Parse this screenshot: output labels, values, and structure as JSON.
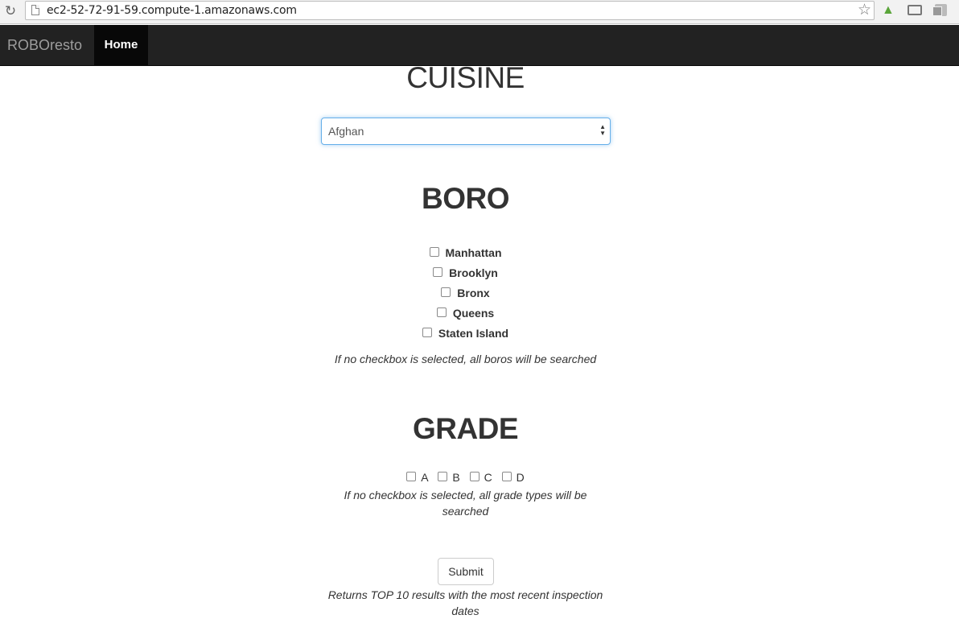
{
  "browser": {
    "url": "ec2-52-72-91-59.compute-1.amazonaws.com",
    "icons": [
      "reload-icon",
      "page-icon",
      "star-icon",
      "tree-extension-icon",
      "cast-icon",
      "copy-extension-icon"
    ]
  },
  "navbar": {
    "brand": "ROBOresto",
    "home": "Home"
  },
  "cuisine": {
    "heading": "CUISINE",
    "selected": "Afghan"
  },
  "boro": {
    "heading": "BORO",
    "options": [
      "Manhattan",
      "Brooklyn",
      "Bronx",
      "Queens",
      "Staten Island"
    ],
    "note": "If no checkbox is selected, all boros will be searched"
  },
  "grade": {
    "heading": "GRADE",
    "options": [
      "A",
      "B",
      "C",
      "D"
    ],
    "note_line1": "If no checkbox is selected, all grade types will be",
    "note_line2": "searched"
  },
  "submit": {
    "label": "Submit",
    "note_line1": "Returns TOP 10 results with the most recent inspection",
    "note_line2": "dates"
  },
  "colors": {
    "navbar_bg": "#222222",
    "nav_active_bg": "#080808",
    "focus_border": "#66afe9"
  }
}
